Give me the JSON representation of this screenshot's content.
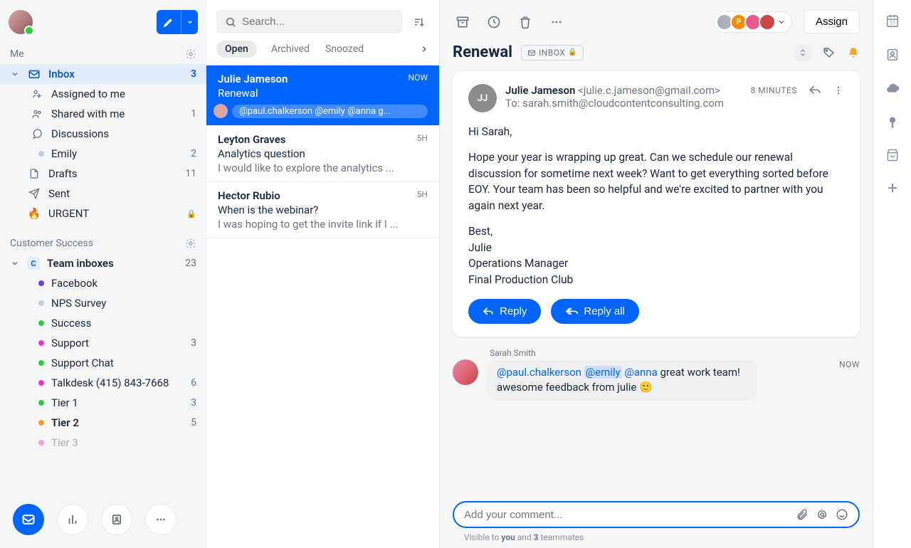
{
  "compose": {
    "label": "Compose"
  },
  "section_me": {
    "title": "Me",
    "items": {
      "inbox": {
        "label": "Inbox",
        "count": "3"
      },
      "assigned": {
        "label": "Assigned to me"
      },
      "shared": {
        "label": "Shared with me",
        "count": "1"
      },
      "discussions": {
        "label": "Discussions"
      },
      "emily": {
        "label": "Emily",
        "count": "2"
      },
      "drafts": {
        "label": "Drafts",
        "count": "11"
      },
      "sent": {
        "label": "Sent"
      },
      "urgent": {
        "label": "URGENT",
        "icon": "🔥"
      }
    }
  },
  "section_cs": {
    "title": "Customer Success",
    "team_inboxes": {
      "label": "Team inboxes",
      "count": "23"
    },
    "channels": [
      {
        "label": "Facebook",
        "dot": "#6b3dff",
        "count": ""
      },
      {
        "label": "NPS Survey",
        "dot": "#c7cdd4",
        "count": ""
      },
      {
        "label": "Success",
        "dot": "#2ecc40",
        "count": ""
      },
      {
        "label": "Support",
        "dot": "#ff2dd0",
        "count": "3"
      },
      {
        "label": "Support Chat",
        "dot": "#2ecc40",
        "count": ""
      },
      {
        "label": "Talkdesk (415) 843-7668",
        "dot": "#ff2dd0",
        "count": "6"
      },
      {
        "label": "Tier 1",
        "dot": "#2ecc40",
        "count": "3"
      },
      {
        "label": "Tier 2",
        "dot": "#ff9a2d",
        "count": "5",
        "bold": true
      },
      {
        "label": "Tier 3",
        "dot": "#f0b",
        "count": "",
        "faded": true
      }
    ]
  },
  "search": {
    "placeholder": "Search..."
  },
  "tabs": {
    "open": "Open",
    "archived": "Archived",
    "snoozed": "Snoozed"
  },
  "conversations": [
    {
      "from": "Julie Jameson",
      "time": "NOW",
      "subject": "Renewal",
      "mentions": "@paul.chalkerson @emily @anna g..."
    },
    {
      "from": "Leyton Graves",
      "time": "5H",
      "subject": "Analytics question",
      "preview": "I would like to explore the analytics ..."
    },
    {
      "from": "Hector Rubio",
      "time": "5H",
      "subject": "When is the webinar?",
      "preview": "I was hoping to get the invite link if I ..."
    }
  ],
  "header": {
    "assign": "Assign",
    "subject": "Renewal",
    "badge": "INBOX"
  },
  "assignee_colors": [
    "#a8b0b8",
    "#ff8a00",
    "#e85a8a",
    "#c44"
  ],
  "message": {
    "initials": "JJ",
    "from_name": "Julie Jameson",
    "from_email": "<julie.c.jameson@gmail.com>",
    "to_label": "To: ",
    "to": "sarah.smith@cloudcontentconsulting.com",
    "time": "8 MINUTES",
    "greeting": "Hi Sarah,",
    "p1": "Hope your year is wrapping up great. Can we schedule our renewal discussion for sometime next week? Want to get everything sorted before EOY. Your team has been so helpful and we're excited to partner with you again next year.",
    "closing": "Best,",
    "sig1": "Julie",
    "sig2": "Operations Manager",
    "sig3": "Final Production Club",
    "reply": "Reply",
    "reply_all": "Reply all"
  },
  "comment": {
    "author": "Sarah Smith",
    "m1": "@paul.chalkerson",
    "m2": "@emily",
    "m3": "@anna",
    "text": " great work team! awesome feedback from julie 🙂",
    "time": "NOW"
  },
  "composer": {
    "placeholder": "Add your comment...",
    "visibility_pre": "Visible to ",
    "visibility_you": "you",
    "visibility_and": " and ",
    "visibility_n": "3",
    "visibility_post": " teammates"
  }
}
